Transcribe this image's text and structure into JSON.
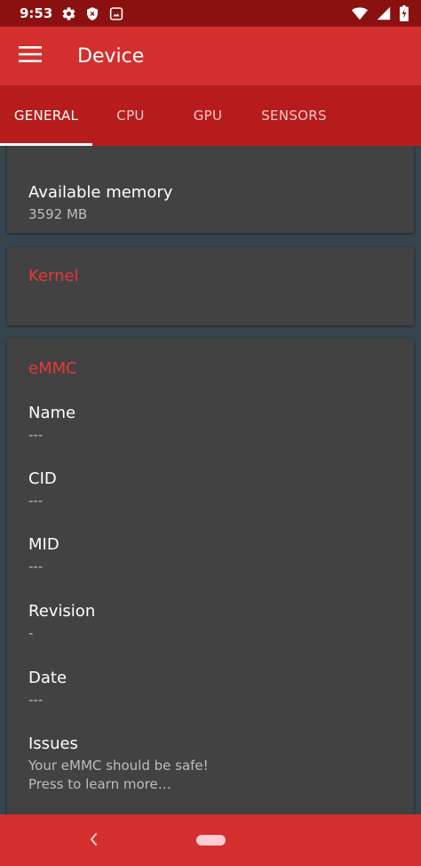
{
  "status_bar": {
    "time": "9:53"
  },
  "app_bar": {
    "title": "Device"
  },
  "tabs": [
    {
      "label": "GENERAL",
      "active": true
    },
    {
      "label": "CPU",
      "active": false
    },
    {
      "label": "GPU",
      "active": false
    },
    {
      "label": "SENSORS",
      "active": false
    }
  ],
  "memory_card": {
    "items": [
      {
        "label": "Available memory",
        "value": "3592 MB"
      }
    ]
  },
  "kernel_card": {
    "title": "Kernel"
  },
  "emmc_card": {
    "title": "eMMC",
    "items": [
      {
        "label": "Name",
        "value": "---"
      },
      {
        "label": "CID",
        "value": "---"
      },
      {
        "label": "MID",
        "value": "---"
      },
      {
        "label": "Revision",
        "value": "-"
      },
      {
        "label": "Date",
        "value": "---"
      },
      {
        "label": "Issues",
        "value": "Your eMMC should be safe!",
        "value2": "Press to learn more…"
      }
    ]
  },
  "colors": {
    "status_bar": "#8b1111",
    "app_bar": "#d32f2f",
    "tab_bar": "#b71c1c",
    "card_bg": "#424242",
    "accent_title": "#e53935",
    "background": "#36454d"
  }
}
